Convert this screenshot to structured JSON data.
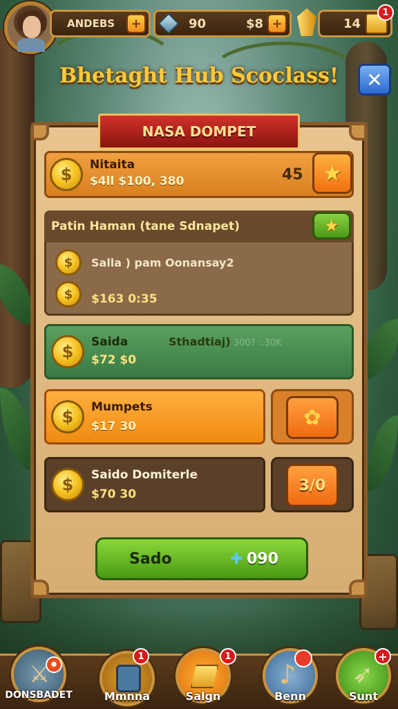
{
  "hud": {
    "player_name": "ANDEBS",
    "gems": "90",
    "coins": "$8",
    "chests": "14",
    "notification_count": "1"
  },
  "title": "Bhetaght Hub Scoclass!",
  "panel": {
    "banner": "NASA DOMPET",
    "rows": [
      {
        "name": "Nitaita",
        "amount": "$4ll $100, 380",
        "value": "45",
        "icon": "star-icon"
      },
      {
        "header": "Patin Haman (tane Sdnapet)",
        "line1": "Salla ) pam Oonansay2",
        "line2": "$163 0:35",
        "icon": "star-icon"
      },
      {
        "name": "Saida",
        "amount": "$72 $0",
        "extra": "Sthadtiaj)",
        "faint": "300? :.30K"
      },
      {
        "name": "Mumpets",
        "amount": "$17 30",
        "icon": "flower-icon"
      },
      {
        "name": "Saido Domiterle",
        "amount": "$70 30",
        "button": "3/0"
      }
    ],
    "cta": {
      "label": "Sado",
      "value": "090"
    }
  },
  "nav": [
    {
      "label": "DONSBADET",
      "badge": "",
      "icon": "warrior-icon"
    },
    {
      "label": "Mmnna",
      "badge": "1",
      "icon": "map-icon"
    },
    {
      "label": "Salgn",
      "badge": "1",
      "icon": "gold-icon"
    },
    {
      "label": "Benn",
      "badge": "",
      "icon": "horn-icon"
    },
    {
      "label": "Sunt",
      "badge": "+",
      "icon": "sword-icon"
    }
  ],
  "colors": {
    "accent": "#ffc93a",
    "green": "#6fbf2a",
    "orange": "#f5a020",
    "brown": "#6a4628"
  }
}
